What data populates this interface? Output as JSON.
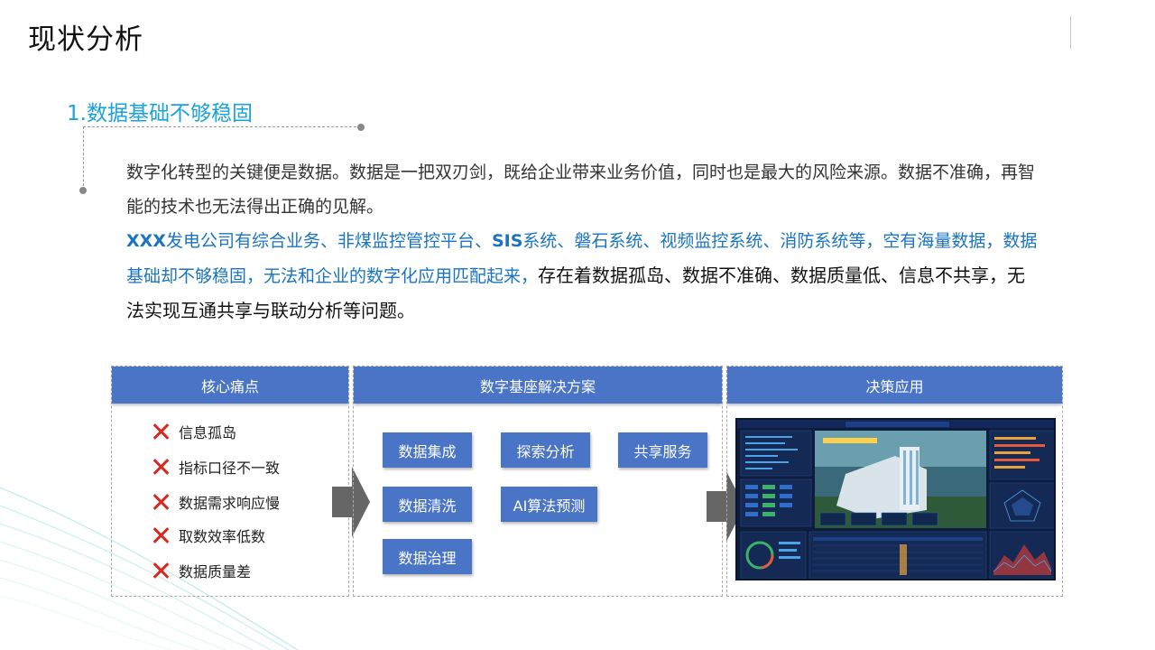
{
  "page": {
    "title": "现状分析"
  },
  "section": {
    "heading": "1.数据基础不够稳固"
  },
  "paragraphs": {
    "p1": "数字化转型的关键便是数据。数据是一把双刃剑，既给企业带来业务价值，同时也是最大的风险来源。数据不准确，再智能的技术也无法得出正确的见解。",
    "p2": {
      "company": "XXX",
      "seg1": "发电公司有综合业务、非煤监控管控平台、",
      "sis": "SIS",
      "seg2": "系统、磐石系统、视频监控系统、消防系统等，空有海量数据，数据基础却不够稳固，无法和企业的数字化应用匹配起来，",
      "seg3": "存在着数据孤岛、数据不准确、数据质量低、信息不共享，无法实现互通共享与联动分析等问题。"
    }
  },
  "pain_points": {
    "header": "核心痛点",
    "items": [
      "信息孤岛",
      "指标口径不一致",
      "数据需求响应慢",
      "取数效率低数",
      "数据质量差"
    ]
  },
  "solution": {
    "header": "数字基座解决方案",
    "buttons": [
      "数据集成",
      "探索分析",
      "共享服务",
      "数据清洗",
      "AI算法预测",
      "数据治理"
    ]
  },
  "decision": {
    "header": "决策应用"
  },
  "colors": {
    "accent": "#1aa3d8",
    "panel_header": "#4a74c6",
    "cross": "#d9281f",
    "highlight_text": "#1a74c2"
  }
}
